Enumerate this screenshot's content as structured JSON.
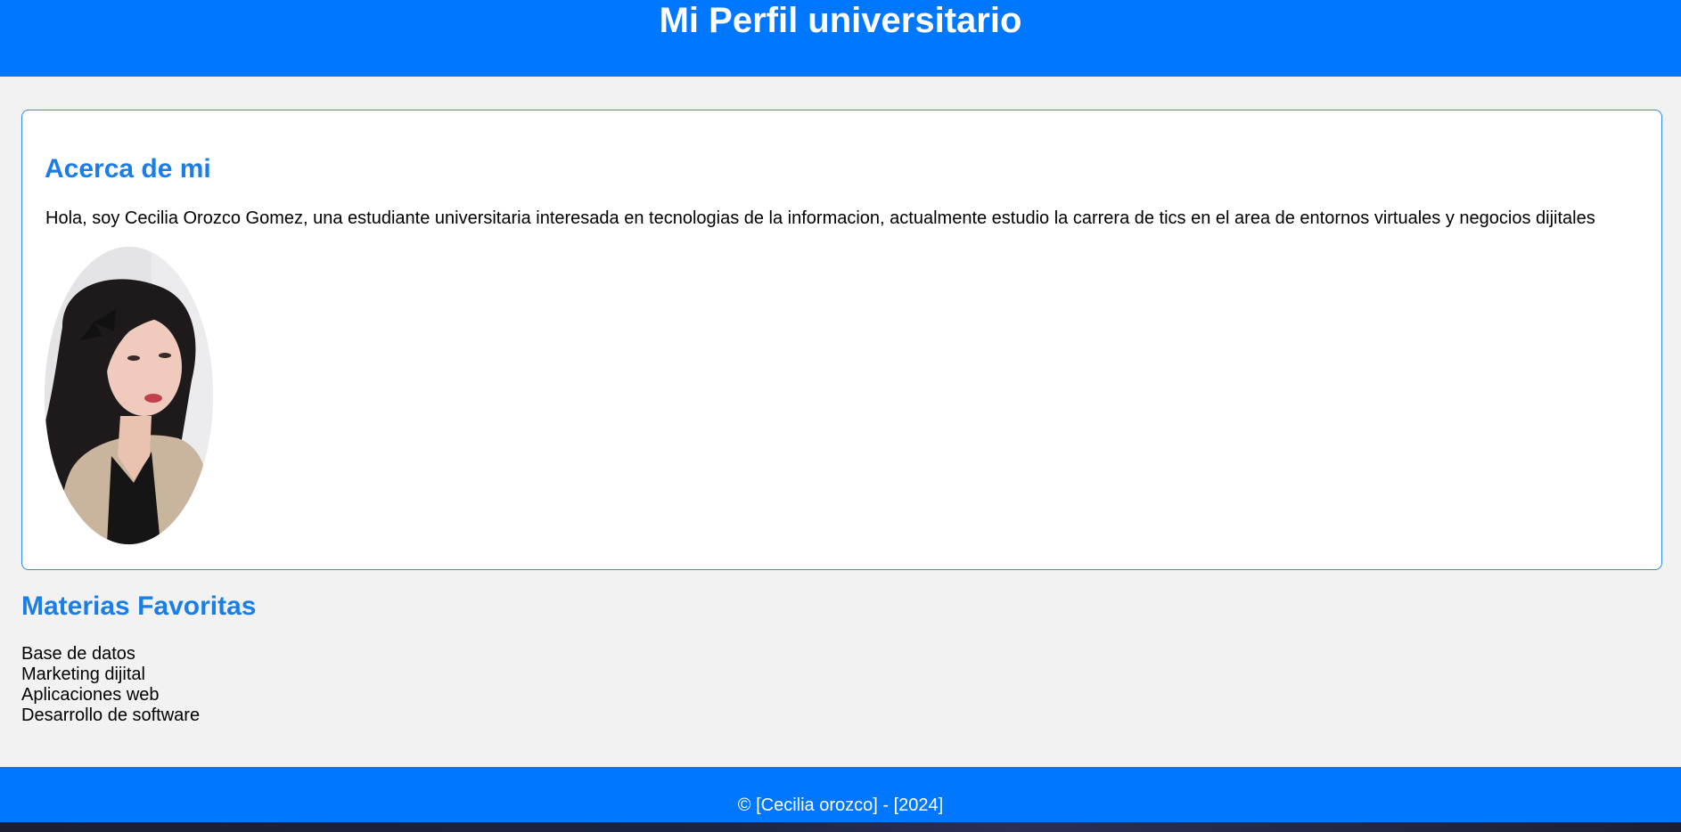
{
  "header": {
    "title": "Mi Perfil universitario"
  },
  "about": {
    "heading": "Acerca de mi",
    "text": "Hola, soy Cecilia Orozco Gomez, una estudiante universitaria interesada en tecnologias de la informacion, actualmente estudio la carrera de tics en el area de entornos virtuales y negocios dijitales"
  },
  "subjects": {
    "heading": "Materias Favoritas",
    "items": [
      "Base de datos",
      "Marketing dijital",
      "Aplicaciones web",
      "Desarrollo de software"
    ]
  },
  "footer": {
    "text": "© [Cecilia orozco] - [2024]"
  },
  "colors": {
    "accent": "#0077ff",
    "heading": "#1a7ee6",
    "background": "#f2f2f2"
  }
}
